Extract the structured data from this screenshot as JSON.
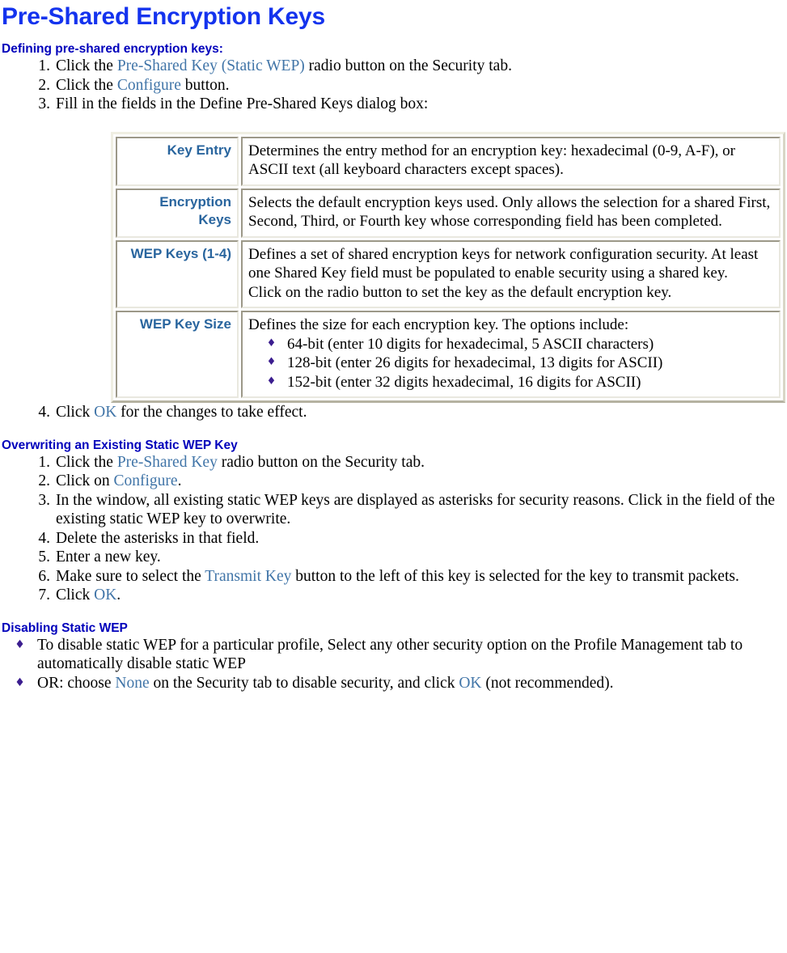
{
  "document": {
    "title": "Pre-Shared Encryption Keys",
    "colors": {
      "title_blue": "#1433ee",
      "heading_navy": "#0000bb",
      "ui_accent": "#4175a8",
      "table_label_blue": "#29659e",
      "bullet_purple": "#3b1d8f"
    }
  },
  "section_defining": {
    "heading": "Defining pre-shared encryption keys:",
    "steps": [
      {
        "num": "1.",
        "parts": [
          {
            "t": "Click the ",
            "ui": false
          },
          {
            "t": "Pre-Shared Key (Static WEP)",
            "ui": true
          },
          {
            "t": " radio button on the Security tab.",
            "ui": false
          }
        ]
      },
      {
        "num": "2.",
        "parts": [
          {
            "t": "Click the ",
            "ui": false
          },
          {
            "t": "Configure",
            "ui": true
          },
          {
            "t": " button.",
            "ui": false
          }
        ]
      },
      {
        "num": "3.",
        "parts": [
          {
            "t": "Fill in the fields in the Define Pre-Shared Keys dialog box:",
            "ui": false
          }
        ]
      }
    ],
    "final_step": {
      "num": "4.",
      "parts": [
        {
          "t": "Click ",
          "ui": false
        },
        {
          "t": "OK",
          "ui": true
        },
        {
          "t": " for the changes to take effect.",
          "ui": false
        }
      ]
    }
  },
  "fields_table": {
    "rows": [
      {
        "label": "Key Entry",
        "paragraphs": [
          "Determines the entry method for an encryption key: hexadecimal (0-9, A-F), or ASCII text (all keyboard characters except spaces)."
        ],
        "bullets": []
      },
      {
        "label": "Encryption Keys",
        "paragraphs": [
          "Selects the default encryption keys used. Only allows the selection for a shared First, Second, Third, or Fourth key whose corresponding field has been completed."
        ],
        "bullets": []
      },
      {
        "label": "WEP Keys (1-4)",
        "paragraphs": [
          "Defines a set of shared encryption keys for network configuration security. At least one Shared Key field must be populated to enable security using a shared key.",
          "Click on the radio button to set the key as the default encryption key."
        ],
        "bullets": []
      },
      {
        "label": "WEP Key Size",
        "paragraphs": [
          "Defines the size for each encryption key. The options include:"
        ],
        "bullets": [
          "64-bit (enter 10 digits for hexadecimal, 5 ASCII characters)",
          "128-bit (enter 26 digits for hexadecimal, 13 digits for ASCII)",
          "152-bit (enter 32 digits hexadecimal, 16 digits for ASCII)"
        ]
      }
    ]
  },
  "section_overwriting": {
    "heading": "Overwriting an Existing Static WEP Key",
    "steps": [
      {
        "num": "1.",
        "parts": [
          {
            "t": "Click the ",
            "ui": false
          },
          {
            "t": "Pre-Shared Key",
            "ui": true
          },
          {
            "t": " radio button on the Security tab.",
            "ui": false
          }
        ]
      },
      {
        "num": "2.",
        "parts": [
          {
            "t": "Click on ",
            "ui": false
          },
          {
            "t": "Configure",
            "ui": true
          },
          {
            "t": ".",
            "ui": false
          }
        ]
      },
      {
        "num": "3.",
        "parts": [
          {
            "t": "In the window, all existing static WEP keys are displayed as asterisks for security reasons. Click in the field of the  existing static WEP key to overwrite.",
            "ui": false
          }
        ]
      },
      {
        "num": "4.",
        "parts": [
          {
            "t": "Delete the asterisks in that field.",
            "ui": false
          }
        ]
      },
      {
        "num": "5.",
        "parts": [
          {
            "t": "Enter a new key.",
            "ui": false
          }
        ]
      },
      {
        "num": "6.",
        "parts": [
          {
            "t": "Make sure to select the ",
            "ui": false
          },
          {
            "t": "Transmit Key",
            "ui": true
          },
          {
            "t": " button to the left of this key is selected for the key to transmit packets.",
            "ui": false
          }
        ]
      },
      {
        "num": "7.",
        "parts": [
          {
            "t": "Click ",
            "ui": false
          },
          {
            "t": "OK",
            "ui": true
          },
          {
            "t": ".",
            "ui": false
          }
        ]
      }
    ]
  },
  "section_disabling": {
    "heading": "Disabling Static WEP",
    "bullets": [
      {
        "parts": [
          {
            "t": "To disable static WEP for a particular profile, Select any other security option on the Profile Management tab to automatically disable static WEP",
            "ui": false
          }
        ]
      },
      {
        "parts": [
          {
            "t": "OR: choose ",
            "ui": false
          },
          {
            "t": "None",
            "ui": true
          },
          {
            "t": " on the Security tab to disable security, and click ",
            "ui": false
          },
          {
            "t": "OK",
            "ui": true
          },
          {
            "t": " (not recommended).",
            "ui": false
          }
        ]
      }
    ]
  },
  "icons": {
    "bullet_glyph": "♦"
  }
}
